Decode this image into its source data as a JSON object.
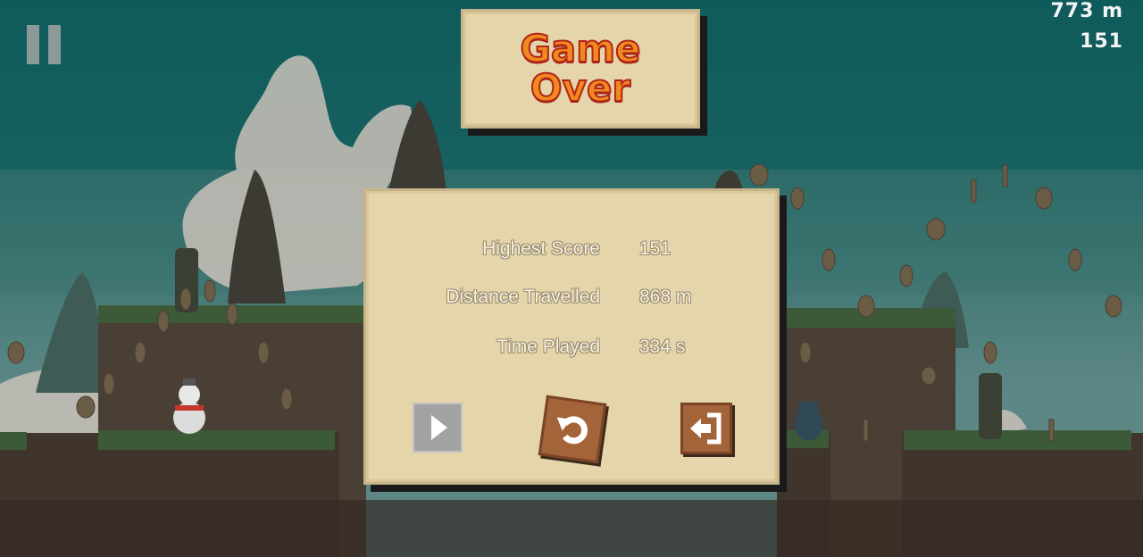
{
  "hud": {
    "distance": "773 m",
    "score": "151"
  },
  "title": {
    "text": "Game\nOver"
  },
  "stats": [
    {
      "label": "Highest Score",
      "value": "151"
    },
    {
      "label": "Distance Travelled",
      "value": "868 m"
    },
    {
      "label": "Time Played",
      "value": "334 s"
    }
  ],
  "buttons": {
    "resume_icon": "play-icon",
    "restart_icon": "restart-icon",
    "exit_icon": "exit-icon"
  },
  "colors": {
    "sky_top": "#0f5b5b",
    "panel_bg": "#e5d5aa",
    "title_fill": "#ef8a1f",
    "title_outline": "#b3241a",
    "button_brown": "#a4643a",
    "button_gray": "#a2a2a2"
  }
}
